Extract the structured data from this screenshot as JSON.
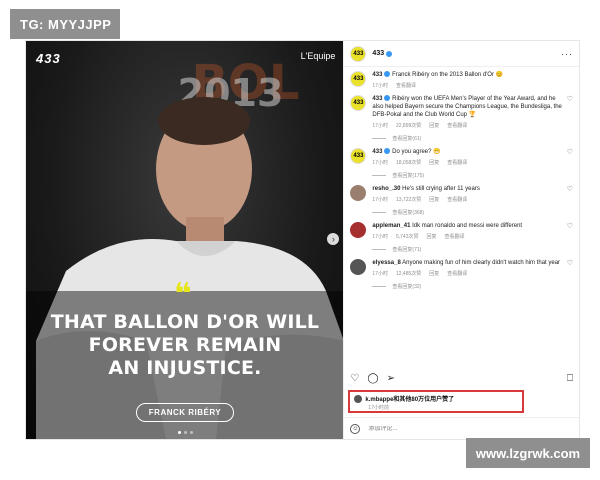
{
  "watermarks": {
    "top_left": "TG: MYYJJPP",
    "bottom_right": "www.lzgrwk.com"
  },
  "media": {
    "brand_logo": "433",
    "source": "L'Equipe",
    "background_text": "BOL",
    "background_year": "2013",
    "quote_glyph": "❝",
    "headline_lines": [
      "THAT BALLON D'OR WILL",
      "FOREVER REMAIN",
      "AN INJUSTICE."
    ],
    "name_pill": "FRANCK RIBÉRY",
    "carousel_next_icon": "chevron-right-icon",
    "carousel_total": 3,
    "carousel_active": 1
  },
  "header": {
    "username": "433",
    "verified": true,
    "more_icon": "ellipsis-icon"
  },
  "comments": [
    {
      "avatar": "433",
      "username": "433",
      "verified": true,
      "text": "Franck Ribéry on the 2013 Ballon d'Or 😊",
      "time": "17小时",
      "translate": "查看翻译",
      "likes": "",
      "reply": "",
      "replies": "",
      "heart": false
    },
    {
      "avatar": "433",
      "username": "433",
      "verified": true,
      "text": "Ribéry won the UEFA Men's Player of the Year Award, and he also helped Bayern secure the Champions League, the Bundesliga, the DFB-Pokal and the Club World Cup 🏆",
      "time": "17小时",
      "likes": "22,899次赞",
      "reply": "回复",
      "translate": "查看翻译",
      "replies": "查看回复(61)",
      "heart": true
    },
    {
      "avatar": "433",
      "username": "433",
      "verified": true,
      "text": "Do you agree? 😁",
      "time": "17小时",
      "likes": "18,058次赞",
      "reply": "回复",
      "translate": "查看翻译",
      "replies": "查看回复(175)",
      "heart": true
    },
    {
      "avatar": "gray",
      "username": "resho_.30",
      "verified": false,
      "text": "He's still crying after 11 years",
      "time": "17小时",
      "likes": "13,722次赞",
      "reply": "回复",
      "translate": "查看翻译",
      "replies": "查看回复(368)",
      "heart": true
    },
    {
      "avatar": "red",
      "username": "appleman_41",
      "verified": false,
      "text": "Idk man ronaldo and messi were different",
      "time": "17小时",
      "likes": "5,743次赞",
      "reply": "回复",
      "translate": "查看翻译",
      "replies": "查看回复(71)",
      "heart": true
    },
    {
      "avatar": "dark",
      "username": "elyessa_8",
      "verified": false,
      "text": "Anyone making fun of him clearly didn't watch him that year",
      "time": "17小时",
      "likes": "12,485次赞",
      "reply": "回复",
      "translate": "查看翻译",
      "replies": "查看回复(32)",
      "heart": true
    }
  ],
  "actions": {
    "like_icon": "heart-icon",
    "comment_icon": "comment-icon",
    "share_icon": "send-icon",
    "save_icon": "bookmark-icon"
  },
  "liked_by": {
    "text": "k.mbappe和其他80万位用户赞了",
    "time": "17小时前"
  },
  "composer": {
    "emoji_icon": "smiley-icon",
    "placeholder": "添加评论..."
  }
}
